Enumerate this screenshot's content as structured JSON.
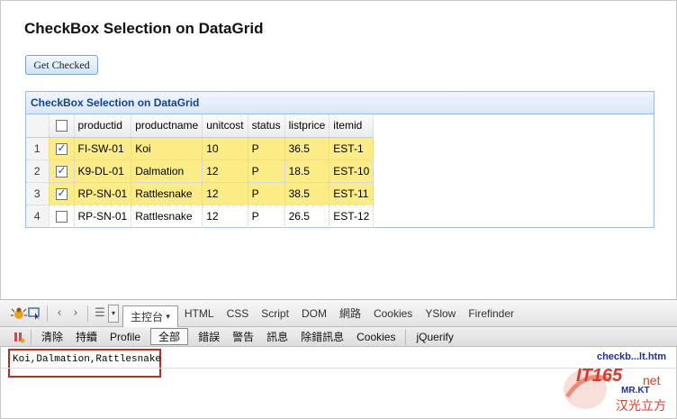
{
  "page": {
    "title": "CheckBox Selection on DataGrid"
  },
  "button": {
    "get_checked": "Get Checked"
  },
  "grid": {
    "title": "CheckBox Selection on DataGrid",
    "columns": [
      "productid",
      "productname",
      "unitcost",
      "status",
      "listprice",
      "itemid"
    ],
    "rows": [
      {
        "n": "1",
        "checked": true,
        "cells": [
          "FI-SW-01",
          "Koi",
          "10",
          "P",
          "36.5",
          "EST-1"
        ]
      },
      {
        "n": "2",
        "checked": true,
        "cells": [
          "K9-DL-01",
          "Dalmation",
          "12",
          "P",
          "18.5",
          "EST-10"
        ]
      },
      {
        "n": "3",
        "checked": true,
        "cells": [
          "RP-SN-01",
          "Rattlesnake",
          "12",
          "P",
          "38.5",
          "EST-11"
        ]
      },
      {
        "n": "4",
        "checked": false,
        "cells": [
          "RP-SN-01",
          "Rattlesnake",
          "12",
          "P",
          "26.5",
          "EST-12"
        ]
      }
    ]
  },
  "firebug": {
    "tabs": [
      "主控台",
      "HTML",
      "CSS",
      "Script",
      "DOM",
      "網路",
      "Cookies",
      "YSlow",
      "Firefinder"
    ],
    "console_toolbar": [
      "清除",
      "持續",
      "Profile",
      "全部",
      "錯誤",
      "警告",
      "訊息",
      "除錯訊息",
      "Cookies",
      "jQuerify"
    ],
    "output": "Koi,Dalmation,Rattlesnake",
    "file_link": "checkb...lt.htm"
  },
  "watermark": {
    "line1": "IT165",
    "line2": "net",
    "line3": "MR.KT",
    "line4": "汉光立方"
  },
  "colors": {
    "selected_row": "#fbec88",
    "grid_border": "#99bbe8",
    "grid_title": "#15428b",
    "highlight_box": "#c2291f"
  }
}
